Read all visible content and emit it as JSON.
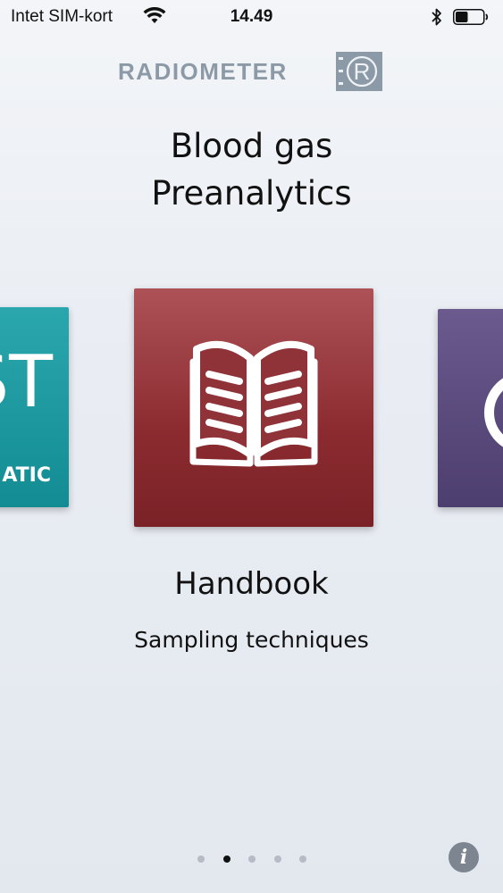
{
  "status_bar": {
    "carrier": "Intet SIM-kort",
    "time": "14.49",
    "wifi_icon": "wifi-icon",
    "bluetooth_icon": "bluetooth-icon",
    "battery_icon": "battery-icon",
    "battery_level_percent": 45
  },
  "logo": {
    "text": "RADIOMETER",
    "mark_letter": "R",
    "color": "#8b9aa6"
  },
  "app_title": {
    "line1": "Blood gas",
    "line2": "Preanalytics"
  },
  "carousel": {
    "left_tile": {
      "big_text": "ST",
      "small_text": "ATIC",
      "color": "#1e9aa1"
    },
    "center_tile": {
      "icon": "open-book-icon",
      "color": "#9a3a3f"
    },
    "right_tile": {
      "icon": "ring-icon",
      "color": "#5a4a7e"
    },
    "current_item": {
      "title": "Handbook",
      "subtitle": "Sampling techniques"
    }
  },
  "pagination": {
    "count": 5,
    "active_index": 1
  },
  "info_button": {
    "label": "i",
    "icon": "info-icon"
  }
}
